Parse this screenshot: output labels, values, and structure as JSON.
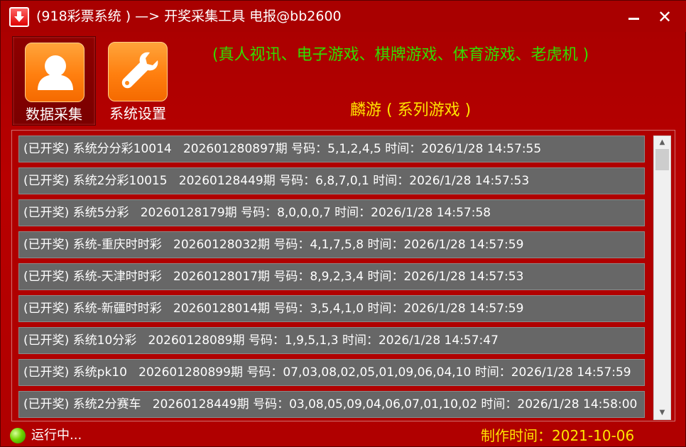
{
  "title": "(918彩票系统 ) —> 开奖采集工具 电报@bb2600",
  "toolbar": {
    "data_collect_label": "数据采集",
    "settings_label": "系统设置"
  },
  "banners": {
    "line1": "(真人视讯、电子游戏、棋牌游戏、体育游戏、老虎机 )",
    "line2": "麟游 ( 系列游戏 )"
  },
  "results": [
    "(已开奖) 系统分分彩10014   202601280897期 号码：5,1,2,4,5 时间：2026/1/28 14:57:55",
    "(已开奖) 系统2分彩10015   20260128449期 号码：6,8,7,0,1 时间：2026/1/28 14:57:53",
    "(已开奖) 系统5分彩   20260128179期 号码：8,0,0,0,7 时间：2026/1/28 14:57:58",
    "(已开奖) 系统-重庆时时彩   20260128032期 号码：4,1,7,5,8 时间：2026/1/28 14:57:59",
    "(已开奖) 系统-天津时时彩   20260128017期 号码：8,9,2,3,4 时间：2026/1/28 14:57:53",
    "(已开奖) 系统-新疆时时彩   20260128014期 号码：3,5,4,1,0 时间：2026/1/28 14:57:59",
    "(已开奖) 系统10分彩   20260128089期 号码：1,9,5,1,3 时间：2026/1/28 14:57:47",
    "(已开奖) 系统pk10   202601280899期 号码：07,03,08,02,05,01,09,06,04,10 时间：2026/1/28 14:57:59",
    "(已开奖) 系统2分赛车   20260128449期 号码：03,08,05,09,04,06,07,01,10,02 时间：2026/1/28 14:58:00"
  ],
  "status": {
    "text": "运行中...",
    "build_date": "制作时间：2021-10-06"
  },
  "colors": {
    "window_bg": "#b00000",
    "banner_green": "#33dd00",
    "banner_yellow": "#ffe400",
    "row_bg": "#676767",
    "icon_orange": "#ff8a1a"
  },
  "icons": {
    "app": "download-arrow-icon",
    "data_collect": "user-icon",
    "settings": "wrench-icon",
    "status": "green-status-icon"
  }
}
